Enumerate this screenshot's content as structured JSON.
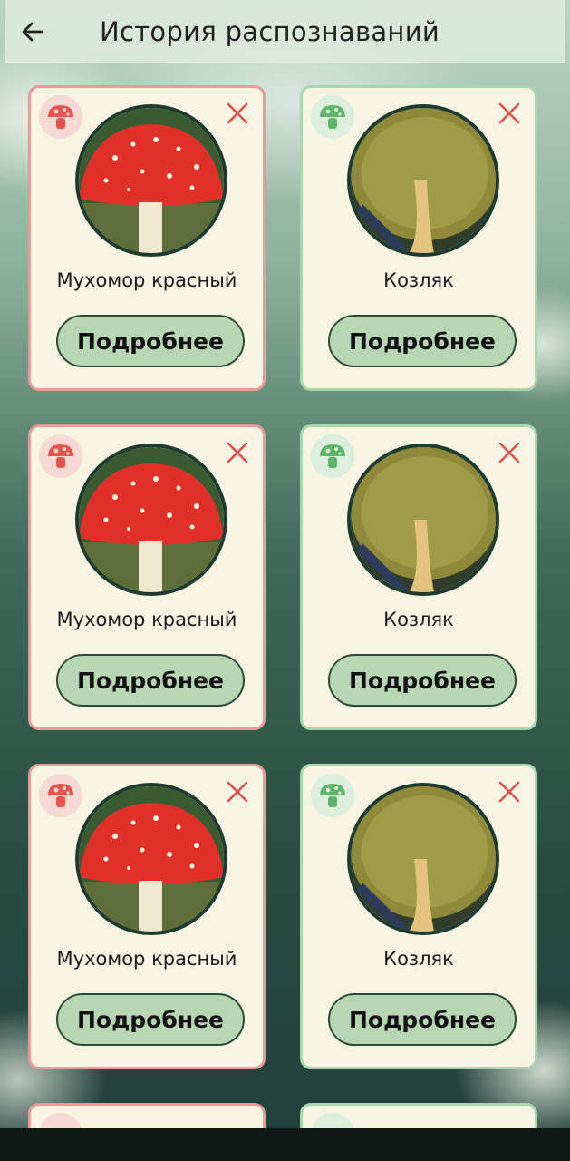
{
  "header": {
    "title": "История распознаваний",
    "back_icon": "arrow-left-icon"
  },
  "cards": [
    {
      "name": "Мухомор красный",
      "button": "Подробнее",
      "kind": "toxic"
    },
    {
      "name": "Козляк",
      "button": "Подробнее",
      "kind": "edible"
    },
    {
      "name": "Мухомор красный",
      "button": "Подробнее",
      "kind": "toxic"
    },
    {
      "name": "Козляк",
      "button": "Подробнее",
      "kind": "edible"
    },
    {
      "name": "Мухомор красный",
      "button": "Подробнее",
      "kind": "toxic"
    },
    {
      "name": "Козляк",
      "button": "Подробнее",
      "kind": "edible"
    }
  ],
  "colors": {
    "toxic": "#e2544e",
    "edible": "#5fb36a",
    "button_bg": "#b7d6b3",
    "card_bg": "#f7f4e4"
  }
}
